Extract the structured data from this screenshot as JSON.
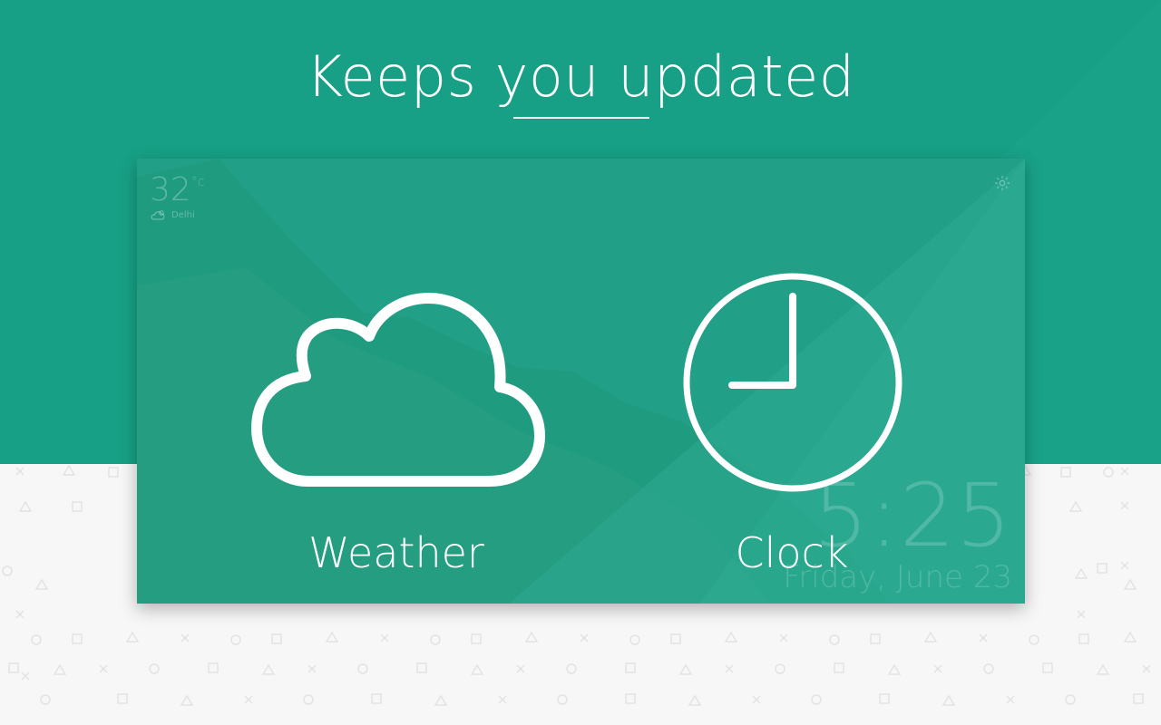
{
  "headline": {
    "text": "Keeps you updated"
  },
  "card": {
    "temperature": "32",
    "temperature_unit": "°c",
    "city": "Delhi",
    "time": "5:25",
    "date": "Friday, June 23"
  },
  "features": {
    "weather_label": "Weather",
    "clock_label": "Clock"
  },
  "colors": {
    "brand_green": "#17a085",
    "card_green": "#22a088",
    "background": "#f7f7f7",
    "text": "#ffffff"
  },
  "icons": [
    "cloud-icon",
    "clock-icon",
    "settings-icon",
    "partly-cloudy-icon"
  ]
}
